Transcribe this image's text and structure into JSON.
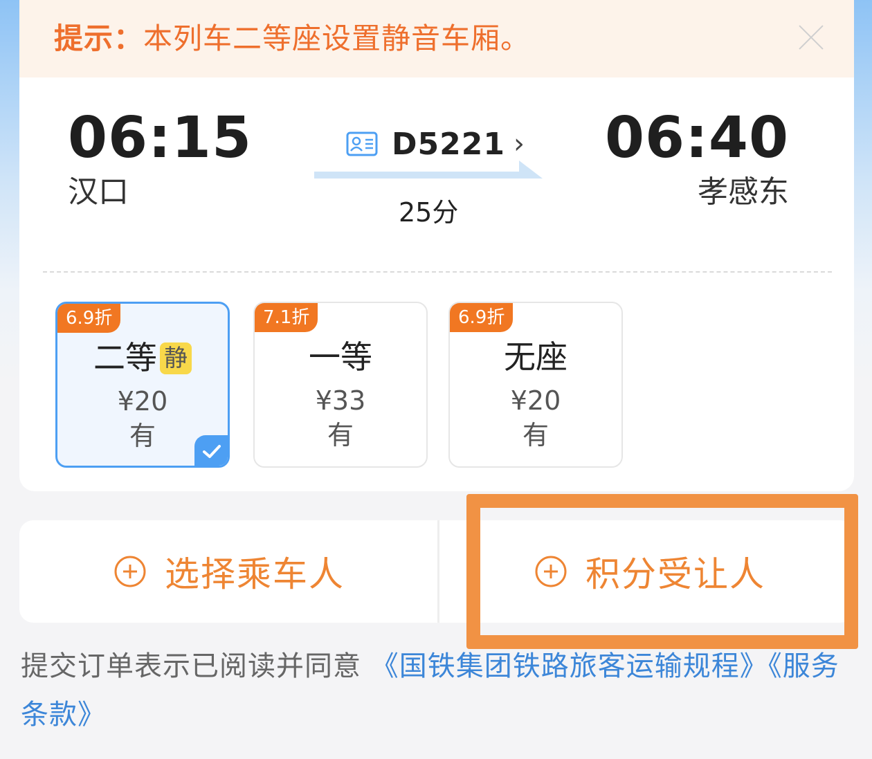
{
  "notice": {
    "label": "提示：",
    "text": "本列车二等座设置静音车厢。"
  },
  "trip": {
    "departure_time": "06:15",
    "departure_station": "汉口",
    "arrival_time": "06:40",
    "arrival_station": "孝感东",
    "train_number": "D5221",
    "duration": "25分"
  },
  "seats": [
    {
      "discount": "6.9折",
      "name": "二等",
      "tag": "静",
      "price": "¥20",
      "availability": "有",
      "selected": true
    },
    {
      "discount": "7.1折",
      "name": "一等",
      "tag": "",
      "price": "¥33",
      "availability": "有",
      "selected": false
    },
    {
      "discount": "6.9折",
      "name": "无座",
      "tag": "",
      "price": "¥20",
      "availability": "有",
      "selected": false
    }
  ],
  "actions": {
    "select_passenger": "选择乘车人",
    "points_beneficiary": "积分受让人"
  },
  "agreement": {
    "prefix": "提交订单表示已阅读并同意 ",
    "link1": "《国铁集团铁路旅客运输规程》",
    "link2": "《服务条款》"
  },
  "colors": {
    "accent_orange": "#f17722",
    "selected_blue": "#4d9ff3",
    "link_blue": "#3c86d8",
    "highlight_box": "#f19244"
  },
  "icons": {
    "close": "close-icon",
    "train_id": "id-card-icon",
    "chevron": "chevron-right-icon",
    "plus": "plus-circle-icon",
    "check": "check-icon"
  }
}
